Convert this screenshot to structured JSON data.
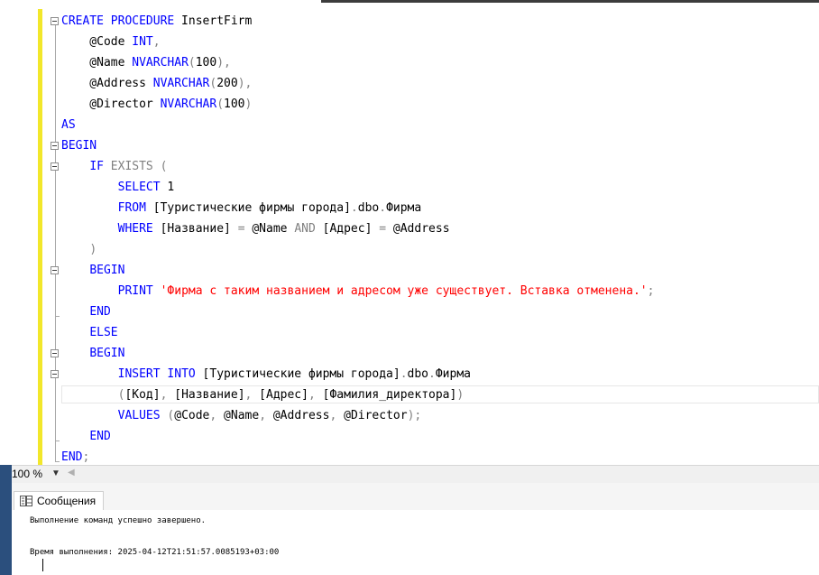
{
  "editor": {
    "lines": [
      [
        [
          "kw",
          "CREATE PROCEDURE"
        ],
        [
          "tx",
          " InsertFirm"
        ]
      ],
      [
        [
          "tx",
          "    @Code "
        ],
        [
          "kw",
          "INT"
        ],
        [
          "gr",
          ","
        ]
      ],
      [
        [
          "tx",
          "    @Name "
        ],
        [
          "kw",
          "NVARCHAR"
        ],
        [
          "gr",
          "("
        ],
        [
          "tx",
          "100"
        ],
        [
          "gr",
          ")"
        ],
        [
          "gr",
          ","
        ]
      ],
      [
        [
          "tx",
          "    @Address "
        ],
        [
          "kw",
          "NVARCHAR"
        ],
        [
          "gr",
          "("
        ],
        [
          "tx",
          "200"
        ],
        [
          "gr",
          ")"
        ],
        [
          "gr",
          ","
        ]
      ],
      [
        [
          "tx",
          "    @Director "
        ],
        [
          "kw",
          "NVARCHAR"
        ],
        [
          "gr",
          "("
        ],
        [
          "tx",
          "100"
        ],
        [
          "gr",
          ")"
        ]
      ],
      [
        [
          "kw",
          "AS"
        ]
      ],
      [
        [
          "kw",
          "BEGIN"
        ]
      ],
      [
        [
          "tx",
          "    "
        ],
        [
          "kw",
          "IF"
        ],
        [
          "tx",
          " "
        ],
        [
          "gr",
          "EXISTS"
        ],
        [
          "tx",
          " "
        ],
        [
          "gr",
          "("
        ]
      ],
      [
        [
          "tx",
          "        "
        ],
        [
          "kw",
          "SELECT"
        ],
        [
          "tx",
          " 1"
        ]
      ],
      [
        [
          "tx",
          "        "
        ],
        [
          "kw",
          "FROM"
        ],
        [
          "tx",
          " [Туристические фирмы города]"
        ],
        [
          "gr",
          "."
        ],
        [
          "tx",
          "dbo"
        ],
        [
          "gr",
          "."
        ],
        [
          "tx",
          "Фирма"
        ]
      ],
      [
        [
          "tx",
          "        "
        ],
        [
          "kw",
          "WHERE"
        ],
        [
          "tx",
          " [Название] "
        ],
        [
          "gr",
          "="
        ],
        [
          "tx",
          " @Name "
        ],
        [
          "gr",
          "AND"
        ],
        [
          "tx",
          " [Адрес] "
        ],
        [
          "gr",
          "="
        ],
        [
          "tx",
          " @Address"
        ]
      ],
      [
        [
          "tx",
          "    "
        ],
        [
          "gr",
          ")"
        ]
      ],
      [
        [
          "tx",
          "    "
        ],
        [
          "kw",
          "BEGIN"
        ]
      ],
      [
        [
          "tx",
          "        "
        ],
        [
          "kw",
          "PRINT"
        ],
        [
          "tx",
          " "
        ],
        [
          "st",
          "'Фирма с таким названием и адресом уже существует. Вставка отменена.'"
        ],
        [
          "gr",
          ";"
        ]
      ],
      [
        [
          "tx",
          "    "
        ],
        [
          "kw",
          "END"
        ]
      ],
      [
        [
          "tx",
          "    "
        ],
        [
          "kw",
          "ELSE"
        ]
      ],
      [
        [
          "tx",
          "    "
        ],
        [
          "kw",
          "BEGIN"
        ]
      ],
      [
        [
          "tx",
          "        "
        ],
        [
          "kw",
          "INSERT INTO"
        ],
        [
          "tx",
          " [Туристические фирмы города]"
        ],
        [
          "gr",
          "."
        ],
        [
          "tx",
          "dbo"
        ],
        [
          "gr",
          "."
        ],
        [
          "tx",
          "Фирма"
        ]
      ],
      [
        [
          "tx",
          "        "
        ],
        [
          "gr",
          "("
        ],
        [
          "tx",
          "[Код]"
        ],
        [
          "gr",
          ","
        ],
        [
          "tx",
          " [Название]"
        ],
        [
          "gr",
          ","
        ],
        [
          "tx",
          " [Адрес]"
        ],
        [
          "gr",
          ","
        ],
        [
          "tx",
          " [Фамилия_директора]"
        ],
        [
          "gr",
          ")"
        ]
      ],
      [
        [
          "tx",
          "        "
        ],
        [
          "kw",
          "VALUES"
        ],
        [
          "tx",
          " "
        ],
        [
          "gr",
          "("
        ],
        [
          "tx",
          "@Code"
        ],
        [
          "gr",
          ","
        ],
        [
          "tx",
          " @Name"
        ],
        [
          "gr",
          ","
        ],
        [
          "tx",
          " @Address"
        ],
        [
          "gr",
          ","
        ],
        [
          "tx",
          " @Director"
        ],
        [
          "gr",
          ")"
        ],
        [
          "gr",
          ";"
        ]
      ],
      [
        [
          "tx",
          "    "
        ],
        [
          "kw",
          "END"
        ]
      ],
      [
        [
          "kw",
          "END"
        ],
        [
          "gr",
          ";"
        ]
      ]
    ]
  },
  "zoom": {
    "value": "100 %"
  },
  "results": {
    "tab_label": "Сообщения",
    "message_1": "Выполнение команд успешно завершено.",
    "message_2": "Время выполнения: 2025-04-12T21:51:57.0085193+03:00"
  },
  "colors": {
    "keyword": "#0000ff",
    "operator": "#808080",
    "string": "#ff0000",
    "change_bar": "#f2e72b",
    "left_strip": "#2b4f7d"
  },
  "icons": {
    "fold_toggle": "minus-box",
    "messages_tab": "messages-grid-icon"
  }
}
